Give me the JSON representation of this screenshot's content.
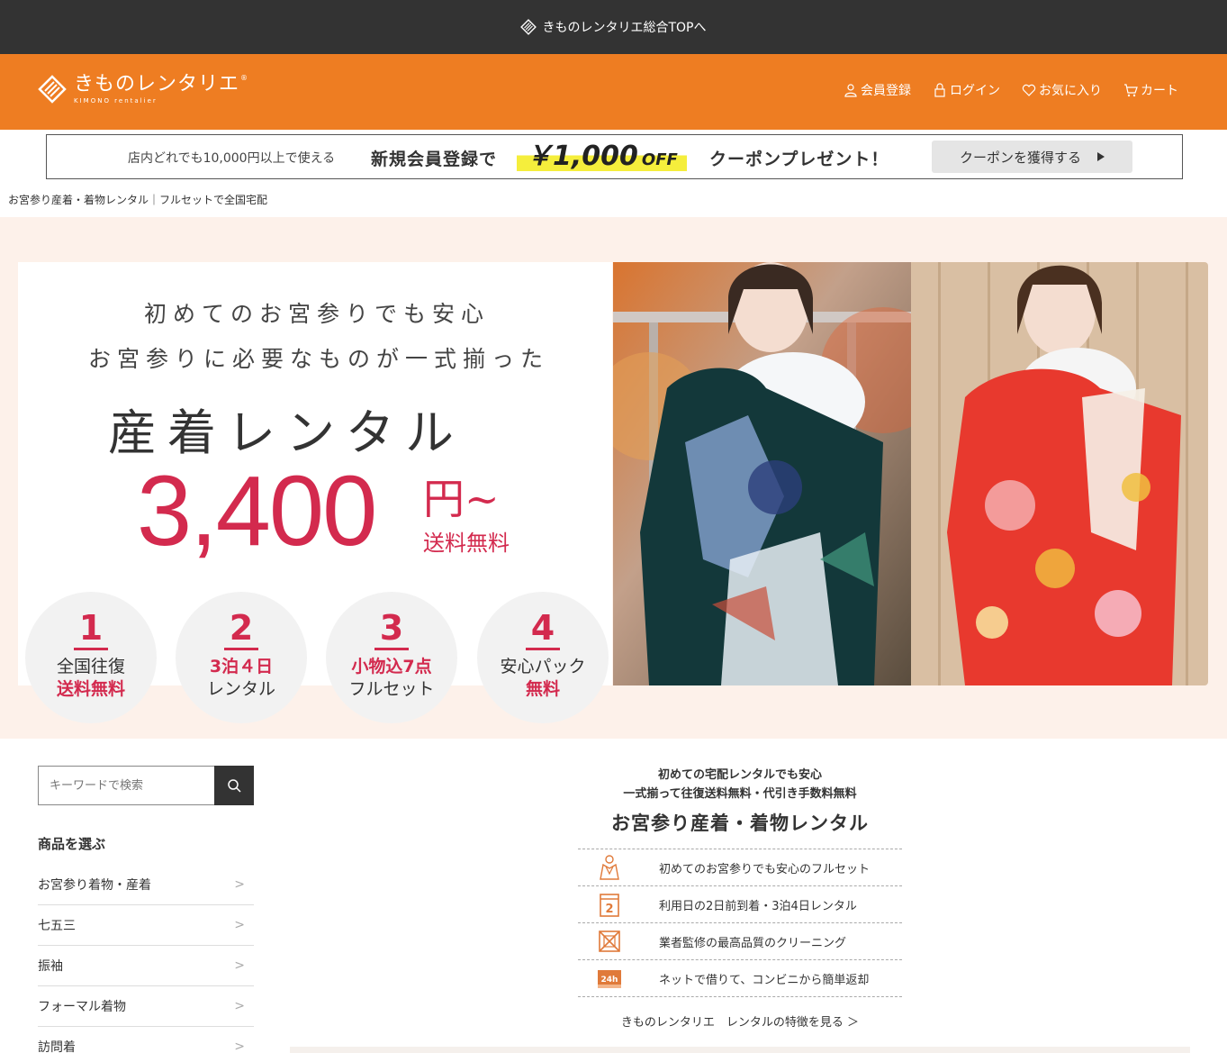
{
  "topbar": {
    "label": "きものレンタリエ総合TOPへ"
  },
  "header": {
    "brand_name": "きものレンタリエ",
    "brand_sub": "KIMONO rentalier",
    "brand_reg": "®",
    "nav": [
      {
        "label": "会員登録",
        "icon": "person-icon"
      },
      {
        "label": "ログイン",
        "icon": "lock-icon"
      },
      {
        "label": "お気に入り",
        "icon": "heart-icon"
      },
      {
        "label": "カート",
        "icon": "cart-icon"
      }
    ]
  },
  "coupon": {
    "small": "店内どれでも10,000円以上で使える",
    "big": "新規会員登録で",
    "amount": "￥1,000",
    "off": "OFF",
    "present": "クーポンプレゼント！",
    "button": "クーポンを獲得する"
  },
  "breadcrumb": "お宮参り産着・着物レンタル｜フルセットで全国宅配",
  "hero": {
    "line1": "初めてのお宮参りでも安心",
    "line2": "お宮参りに必要なものが一式揃った",
    "title": "産着レンタル",
    "price": "3,400",
    "yen": "円~",
    "shipping": "送料無料",
    "features": [
      {
        "num": "1",
        "t1": "全国往復",
        "t2": "送料無料"
      },
      {
        "num": "2",
        "t1": "3泊４日",
        "t2": "レンタル"
      },
      {
        "num": "3",
        "t1": "小物込7点",
        "t2": "フルセット"
      },
      {
        "num": "4",
        "t1": "安心パック",
        "t2": "無料"
      }
    ]
  },
  "sidebar": {
    "search_placeholder": "キーワードで検索",
    "title": "商品を選ぶ",
    "items": [
      "お宮参り着物・産着",
      "七五三",
      "振袖",
      "フォーマル着物",
      "訪問着"
    ],
    "arrow": ">"
  },
  "intro": {
    "s1": "初めての宅配レンタルでも安心",
    "s2": "一式揃って往復送料無料・代引き手数料無料",
    "heading": "お宮参り産着・着物レンタル",
    "points": [
      {
        "text": "初めてのお宮参りでも安心のフルセット",
        "icon": "kimono-icon"
      },
      {
        "text": "利用日の2日前到着・3泊4日レンタル",
        "icon": "calendar-icon"
      },
      {
        "text": "業者監修の最高品質のクリーニング",
        "icon": "cleaning-icon"
      },
      {
        "text": "ネットで借りて、コンビニから簡単返却",
        "icon": "convenience-store-icon"
      }
    ],
    "calendar_digit": "2",
    "store_label": "24h",
    "more": "きものレンタリエ　レンタルの特徴を見る ＞"
  },
  "colors": {
    "orange": "#ee7d22",
    "accent_red": "#d32a4e",
    "dark": "#333333",
    "hero_bg": "#fdf1ea"
  }
}
